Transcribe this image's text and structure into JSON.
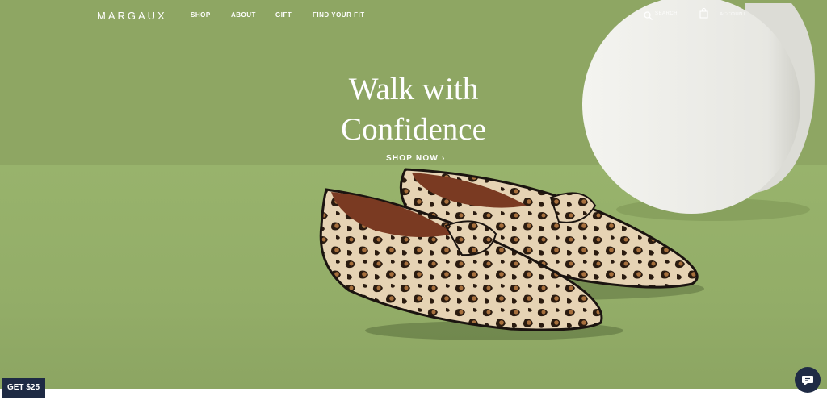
{
  "brand": {
    "logo": "MARGAUX"
  },
  "nav": {
    "links": [
      "SHOP",
      "ABOUT",
      "GIFT",
      "FIND YOUR FIT"
    ],
    "search_label": "SEARCH",
    "account_label": "ACCOUNT"
  },
  "hero": {
    "headline_line1": "Walk with",
    "headline_line2": "Confidence",
    "cta_label": "SHOP NOW ›"
  },
  "promo": {
    "label": "GET $25"
  },
  "icons": {
    "search": "search-icon",
    "account": "bag-icon",
    "chat": "chat-icon"
  },
  "colors": {
    "wall": "#8ea663",
    "floor": "#98b36c",
    "navy": "#1e2a44"
  }
}
